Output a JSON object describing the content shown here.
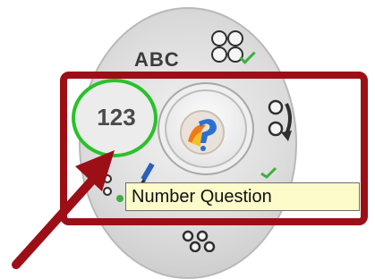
{
  "radial_menu": {
    "text_option_label": "ABC",
    "number_option_label": "123",
    "center_icon": "help-question-icon",
    "multiple_choice_icon": "multiple-choice-icon",
    "ordering_icon": "ordering-icon",
    "edit_icon": "pencil-icon",
    "matrix_icon": "matrix-dots-icon",
    "highlight_color": "#29c229"
  },
  "tooltip": {
    "text": "Number Question"
  },
  "annotation": {
    "frame_color": "#9c0f17",
    "arrow_color": "#9c0f17"
  }
}
